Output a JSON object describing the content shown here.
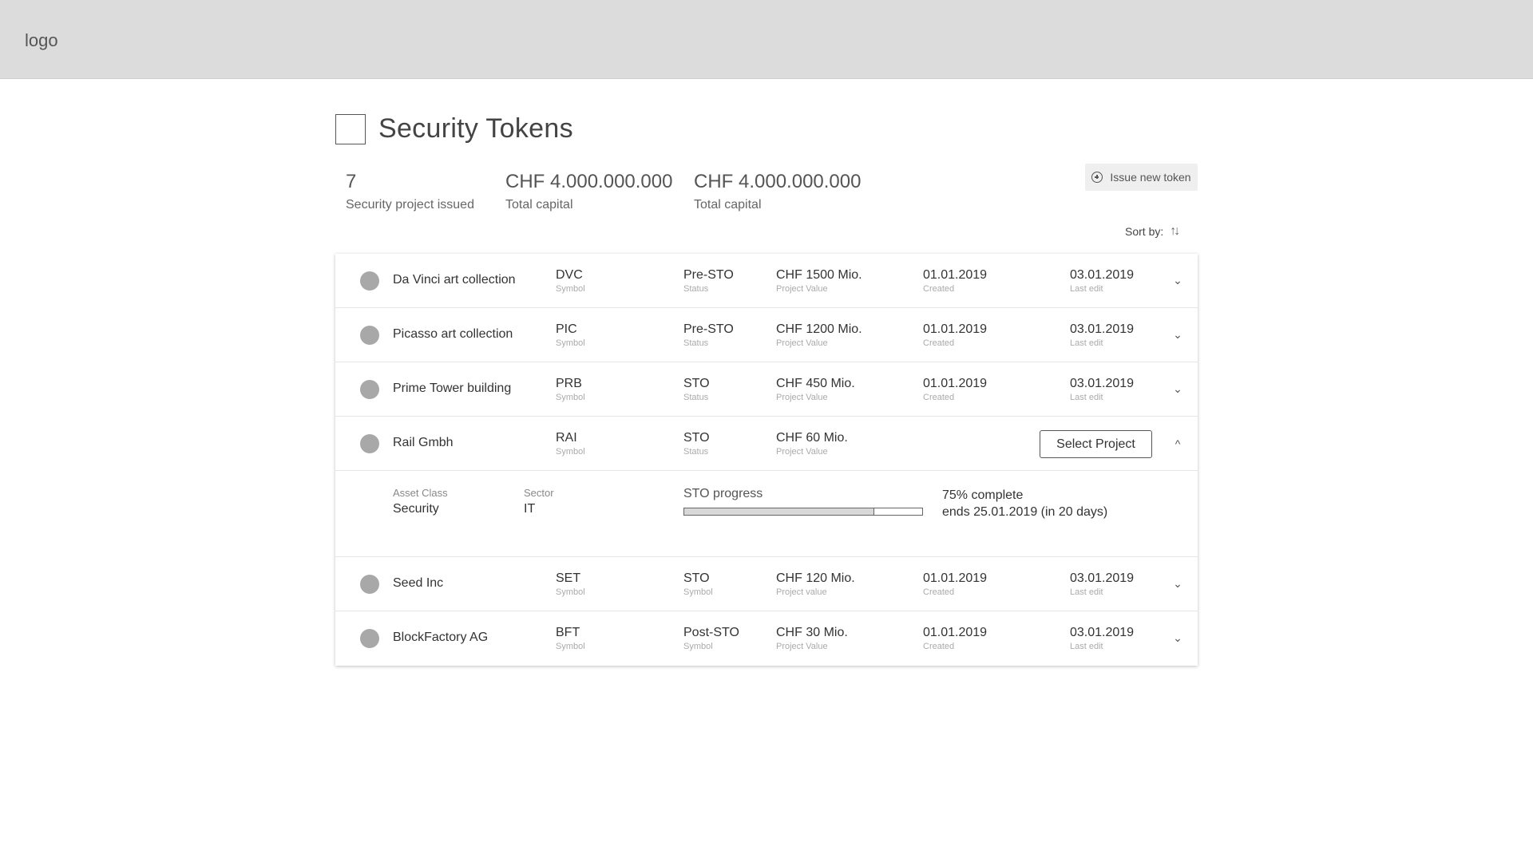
{
  "header": {
    "logo": "logo"
  },
  "page": {
    "title": "Security Tokens"
  },
  "stats": [
    {
      "value": "7",
      "label": "Security project issued"
    },
    {
      "value": "CHF 4.000.000.000",
      "label": "Total capital"
    },
    {
      "value": "CHF 4.000.000.000",
      "label": "Total capital"
    }
  ],
  "actions": {
    "issue_label": "Issue new token",
    "sort_label": "Sort by:",
    "sort_icon": "sort-icon"
  },
  "rows": [
    {
      "name": "Da Vinci art collection",
      "symbol": "DVC",
      "symbol_label": "Symbol",
      "status": "Pre-STO",
      "status_label": "Status",
      "value": "CHF 1500 Mio.",
      "value_label": "Project Value",
      "created": "01.01.2019",
      "created_label": "Created",
      "edit": "03.01.2019",
      "edit_label": "Last edit",
      "chevron": "⌄"
    },
    {
      "name": "Picasso art collection",
      "symbol": "PIC",
      "symbol_label": "Symbol",
      "status": "Pre-STO",
      "status_label": "Status",
      "value": "CHF 1200 Mio.",
      "value_label": "Project Value",
      "created": "01.01.2019",
      "created_label": "Created",
      "edit": "03.01.2019",
      "edit_label": "Last edit",
      "chevron": "⌄"
    },
    {
      "name": "Prime Tower building",
      "symbol": "PRB",
      "symbol_label": "Symbol",
      "status": "STO",
      "status_label": "Status",
      "value": "CHF 450 Mio.",
      "value_label": "Project Value",
      "created": "01.01.2019",
      "created_label": "Created",
      "edit": "03.01.2019",
      "edit_label": "Last edit",
      "chevron": "⌄"
    },
    {
      "name": "Rail Gmbh",
      "symbol": "RAI",
      "symbol_label": "Symbol",
      "status": "STO",
      "status_label": "Status",
      "value": "CHF 60 Mio.",
      "value_label": "Project Value",
      "select_label": "Select Project",
      "chevron": "^"
    },
    {
      "name": "Seed Inc",
      "symbol": "SET",
      "symbol_label": "Symbol",
      "status": "STO",
      "status_label": "Symbol",
      "value": "CHF 120 Mio.",
      "value_label": "Project value",
      "created": "01.01.2019",
      "created_label": "Created",
      "edit": "03.01.2019",
      "edit_label": "Last edit",
      "chevron": "⌄"
    },
    {
      "name": "BlockFactory AG",
      "symbol": "BFT",
      "symbol_label": "Symbol",
      "status": "Post-STO",
      "status_label": "Symbol",
      "value": "CHF 30 Mio.",
      "value_label": "Project Value",
      "created": "01.01.2019",
      "created_label": "Created",
      "edit": "03.01.2019",
      "edit_label": "Last edit",
      "chevron": "⌄"
    }
  ],
  "detail": {
    "asset_class_label": "Asset Class",
    "asset_class": "Security",
    "sector_label": "Sector",
    "sector": "IT",
    "progress_label": "STO progress",
    "progress_value": 0.8,
    "progress_text": "75% complete",
    "ends_text": "ends 25.01.2019 (in 20 days)"
  }
}
